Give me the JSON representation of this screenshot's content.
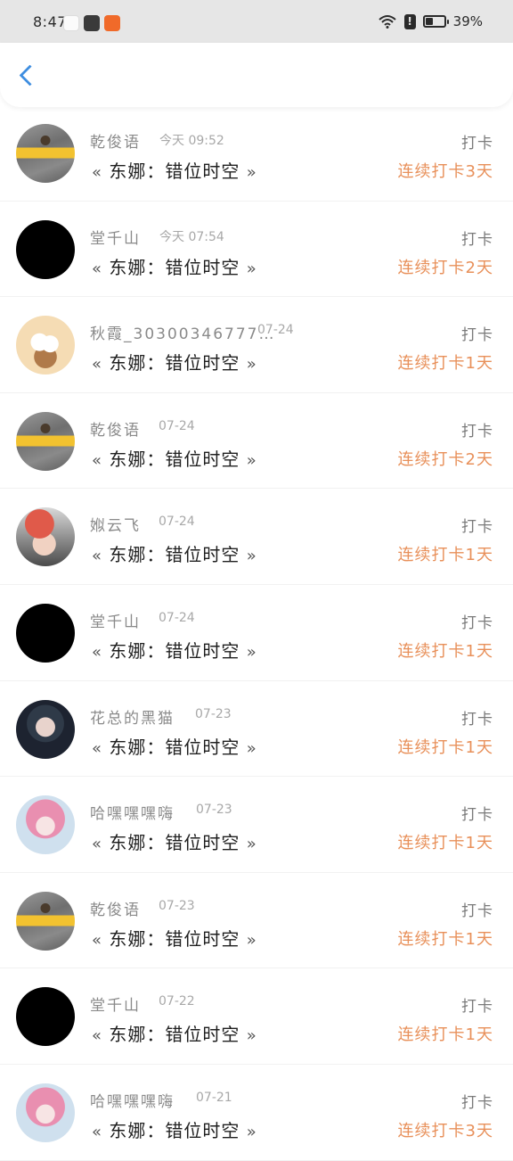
{
  "status_bar": {
    "time": "8:47",
    "battery": "39%",
    "battery_level": 0.39,
    "icons": [
      "wechat-icon",
      "shopping-bag-icon",
      "taobao-icon",
      "wifi-icon",
      "alert-icon",
      "battery-icon"
    ]
  },
  "header": {
    "back_icon": "chevron-left-icon",
    "accent_color": "#3f8ee0"
  },
  "colors": {
    "streak": "#e8905a",
    "name": "#8a8a8a",
    "title": "#1f1f1f"
  },
  "entries": [
    {
      "name": "乾俊语",
      "time": "今天 09:52",
      "book_open": "«",
      "book_title": "东娜：错位时空",
      "book_close": "»",
      "action": "打卡",
      "streak": "连续打卡3天",
      "avatar": "photo-street"
    },
    {
      "name": "堂千山",
      "time": "今天 07:54",
      "book_open": "«",
      "book_title": "东娜：错位时空",
      "book_close": "»",
      "action": "打卡",
      "streak": "连续打卡2天",
      "avatar": "black"
    },
    {
      "name": "秋霞_30300346777…",
      "time": "07-24",
      "book_open": "«",
      "book_title": "东娜：错位时空",
      "book_close": "»",
      "action": "打卡",
      "streak": "连续打卡1天",
      "avatar": "cartoon-cat"
    },
    {
      "name": "乾俊语",
      "time": "07-24",
      "book_open": "«",
      "book_title": "东娜：错位时空",
      "book_close": "»",
      "action": "打卡",
      "streak": "连续打卡2天",
      "avatar": "photo-street"
    },
    {
      "name": "娰云飞",
      "time": "07-24",
      "book_open": "«",
      "book_title": "东娜：错位时空",
      "book_close": "»",
      "action": "打卡",
      "streak": "连续打卡1天",
      "avatar": "helmet-girl"
    },
    {
      "name": "堂千山",
      "time": "07-24",
      "book_open": "«",
      "book_title": "东娜：错位时空",
      "book_close": "»",
      "action": "打卡",
      "streak": "连续打卡1天",
      "avatar": "black"
    },
    {
      "name": "花总的黑猫",
      "time": "07-23",
      "book_open": "«",
      "book_title": "东娜：错位时空",
      "book_close": "»",
      "action": "打卡",
      "streak": "连续打卡1天",
      "avatar": "dark-girl"
    },
    {
      "name": "哈嘿嘿嘿嗨",
      "time": "07-23",
      "book_open": "«",
      "book_title": "东娜：错位时空",
      "book_close": "»",
      "action": "打卡",
      "streak": "连续打卡1天",
      "avatar": "anime-pink"
    },
    {
      "name": "乾俊语",
      "time": "07-23",
      "book_open": "«",
      "book_title": "东娜：错位时空",
      "book_close": "»",
      "action": "打卡",
      "streak": "连续打卡1天",
      "avatar": "photo-street"
    },
    {
      "name": "堂千山",
      "time": "07-22",
      "book_open": "«",
      "book_title": "东娜：错位时空",
      "book_close": "»",
      "action": "打卡",
      "streak": "连续打卡1天",
      "avatar": "black"
    },
    {
      "name": "哈嘿嘿嘿嗨",
      "time": "07-21",
      "book_open": "«",
      "book_title": "东娜：错位时空",
      "book_close": "»",
      "action": "打卡",
      "streak": "连续打卡3天",
      "avatar": "anime-pink"
    }
  ]
}
